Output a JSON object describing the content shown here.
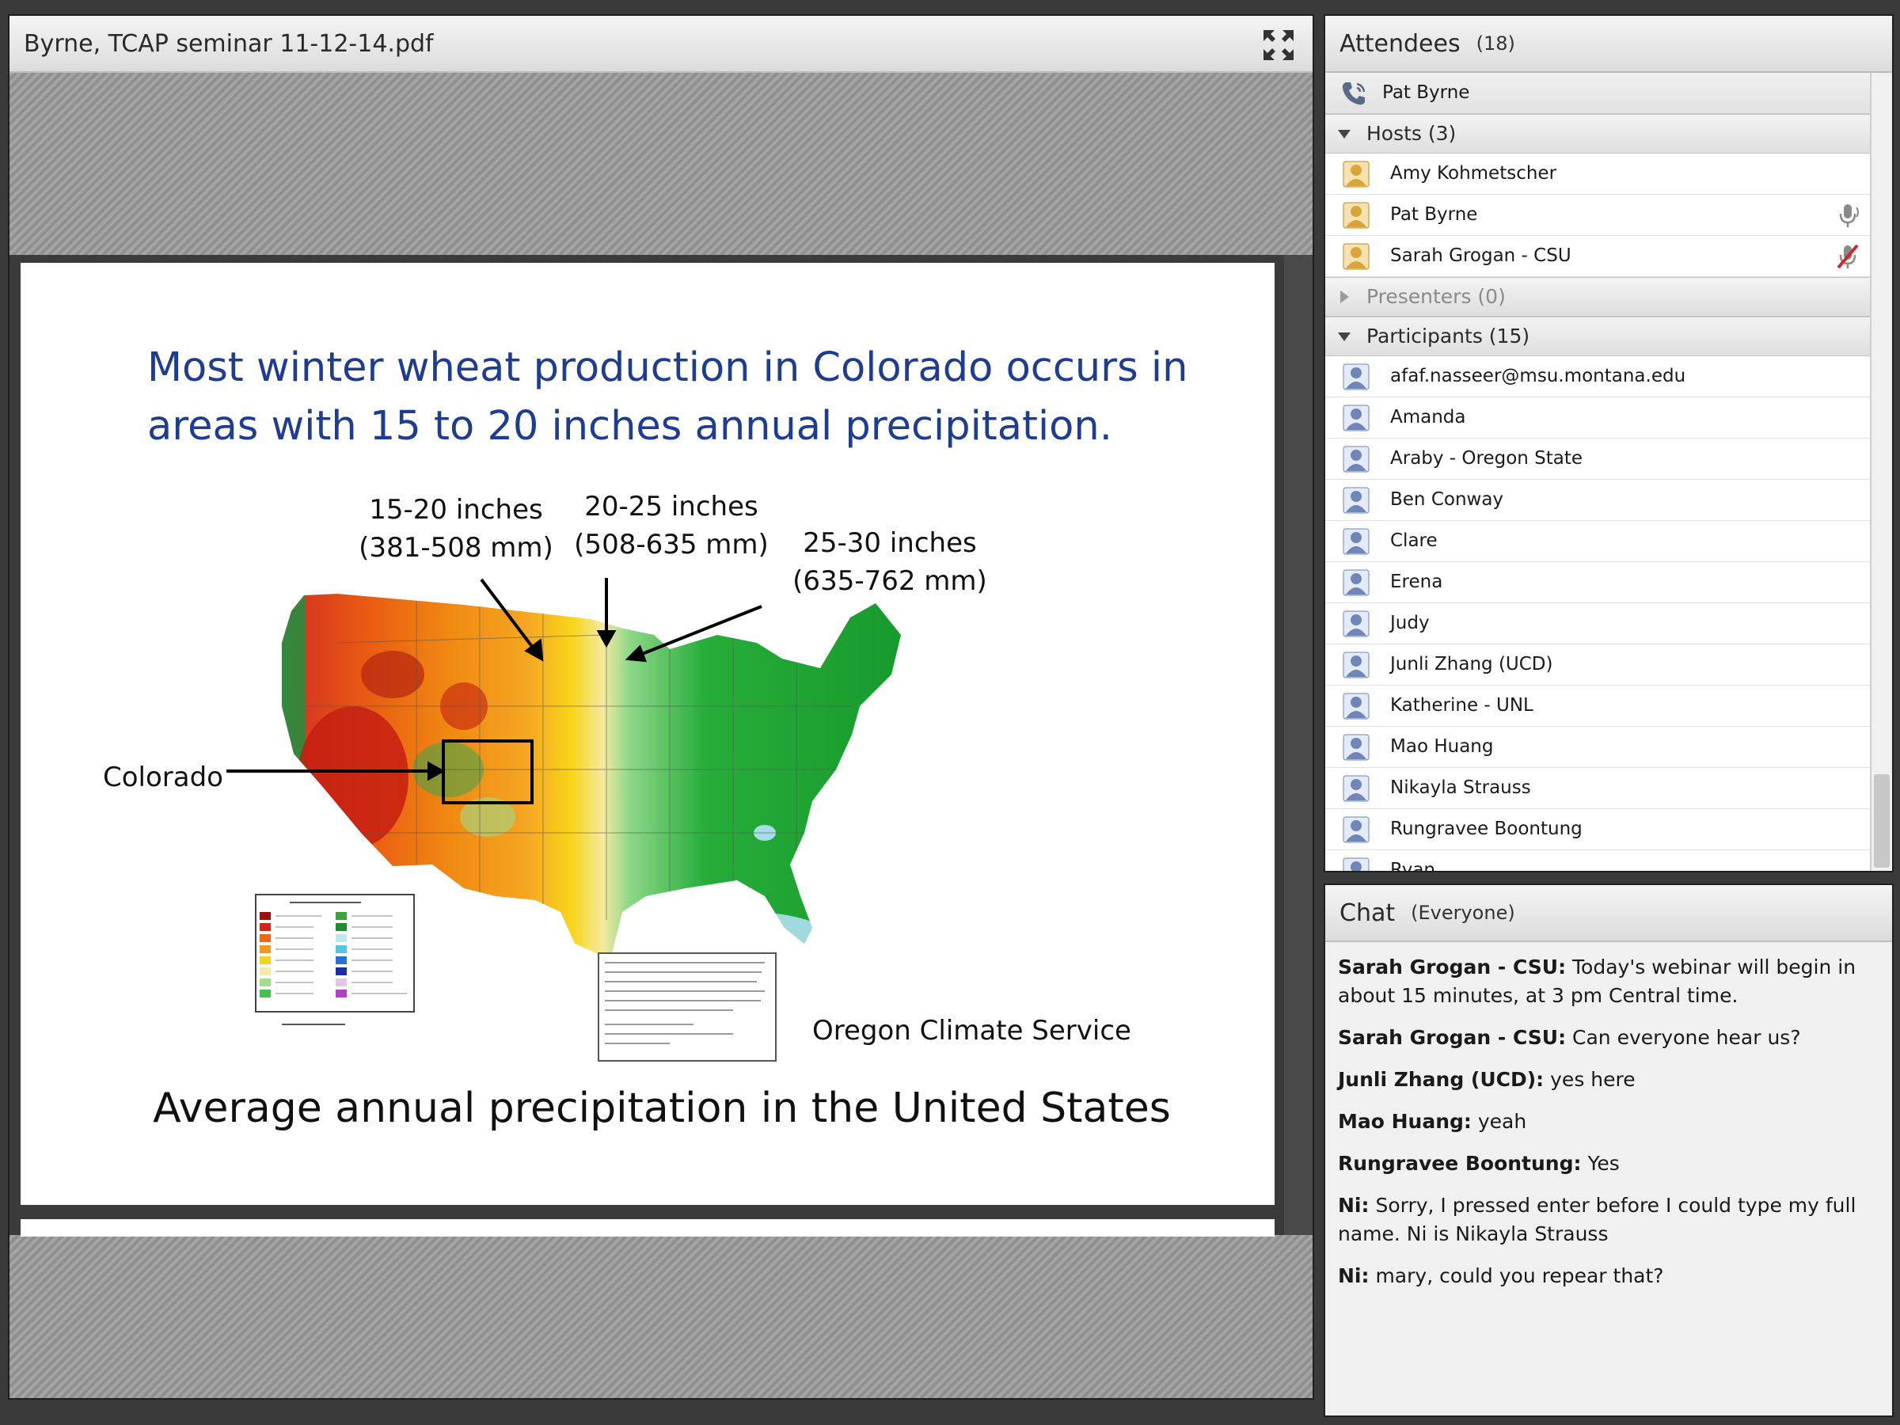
{
  "share_pod": {
    "title": "Byrne, TCAP seminar 11-12-14.pdf",
    "fullscreen_icon": "fullscreen-icon",
    "slide": {
      "title": "Most winter wheat production in Colorado occurs in areas with 15 to 20 inches annual precipitation.",
      "labels": {
        "band1_line1": "15-20 inches",
        "band1_line2": "(381-508 mm)",
        "band2_line1": "20-25 inches",
        "band2_line2": "(508-635 mm)",
        "band3_line1": "25-30 inches",
        "band3_line2": "(635-762 mm)",
        "colorado": "Colorado"
      },
      "credit": "Oregon Climate Service",
      "caption": "Average annual precipitation in the United States"
    }
  },
  "attendees_pod": {
    "title": "Attendees",
    "count": "(18)",
    "me": {
      "name": "Pat Byrne",
      "icon": "phone-icon"
    },
    "groups": {
      "hosts": {
        "label": "Hosts (3)",
        "members": [
          "Amy Kohmetscher",
          "Pat Byrne",
          "Sarah Grogan - CSU"
        ]
      },
      "presenters": {
        "label": "Presenters (0)"
      },
      "participants": {
        "label": "Participants (15)",
        "members": [
          "afaf.nasseer@msu.montana.edu",
          "Amanda",
          "Araby - Oregon State",
          "Ben Conway",
          "Clare",
          "Erena",
          "Judy",
          "Junli Zhang (UCD)",
          "Katherine - UNL",
          "Mao Huang",
          "Nikayla Strauss",
          "Rungravee Boontung",
          "Ryan"
        ]
      }
    },
    "colors": {
      "host_avatar": "#d9a53a",
      "participant_avatar": "#6f86b8",
      "mic_muted": "#d0282a"
    }
  },
  "chat_pod": {
    "title": "Chat",
    "scope": "(Everyone)",
    "messages": [
      {
        "sender": "Sarah Grogan - CSU:",
        "text": "Today's webinar will begin in about 15 minutes, at 3 pm Central time."
      },
      {
        "sender": "Sarah Grogan - CSU:",
        "text": "Can everyone hear us?"
      },
      {
        "sender": "Junli Zhang (UCD):",
        "text": "yes here"
      },
      {
        "sender": "Mao Huang:",
        "text": "yeah"
      },
      {
        "sender": "Rungravee Boontung:",
        "text": "Yes"
      },
      {
        "sender": "Ni:",
        "text": "Sorry, I pressed enter before I could type my full name. Ni is Nikayla Strauss"
      },
      {
        "sender": "Ni:",
        "text": "mary, could you repear that?"
      }
    ]
  }
}
